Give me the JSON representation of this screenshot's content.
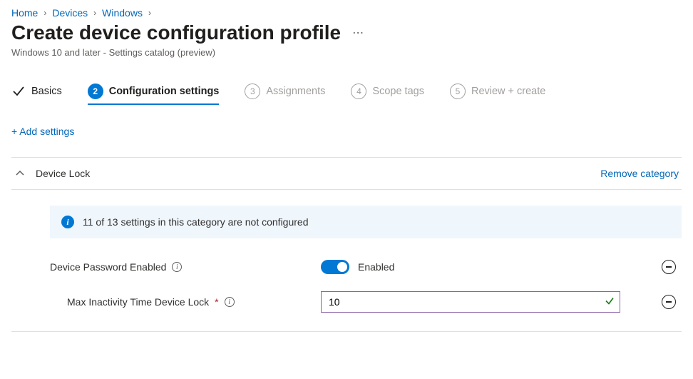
{
  "breadcrumb": {
    "items": [
      "Home",
      "Devices",
      "Windows"
    ]
  },
  "page": {
    "title": "Create device configuration profile",
    "subtitle": "Windows 10 and later - Settings catalog (preview)"
  },
  "wizard": {
    "steps": [
      {
        "label": "Basics"
      },
      {
        "num": "2",
        "label": "Configuration settings"
      },
      {
        "num": "3",
        "label": "Assignments"
      },
      {
        "num": "4",
        "label": "Scope tags"
      },
      {
        "num": "5",
        "label": "Review + create"
      }
    ]
  },
  "actions": {
    "add_settings": "+ Add settings"
  },
  "category": {
    "title": "Device Lock",
    "remove_label": "Remove category",
    "banner": "11 of 13 settings in this category are not configured"
  },
  "settings": {
    "password_enabled": {
      "label": "Device Password Enabled",
      "value_label": "Enabled"
    },
    "max_inactivity": {
      "label": "Max Inactivity Time Device Lock",
      "required_mark": "*",
      "value": "10"
    }
  }
}
